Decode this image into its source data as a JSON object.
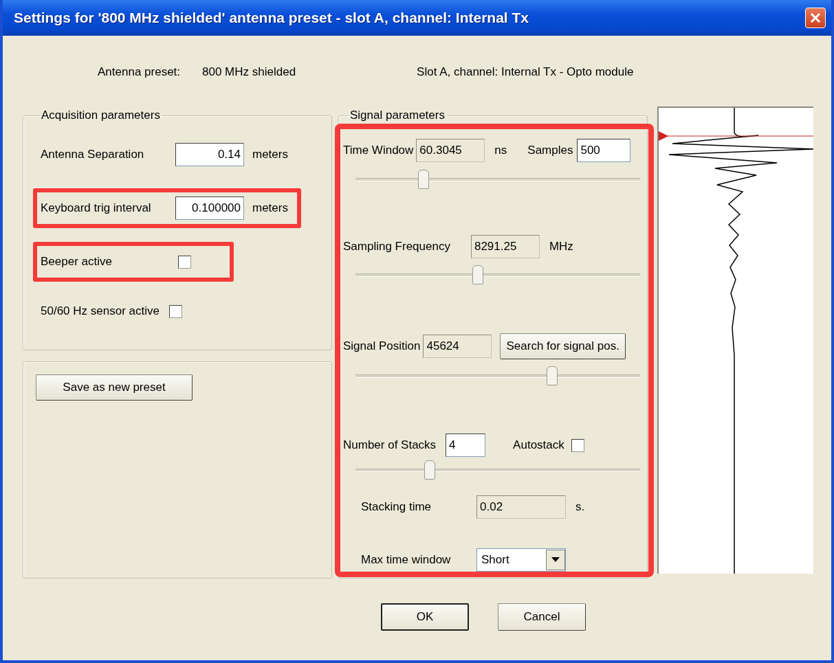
{
  "window": {
    "title": "Settings for '800 MHz shielded' antenna preset - slot A, channel: Internal Tx"
  },
  "header": {
    "preset_label": "Antenna preset:",
    "preset_value": "800 MHz shielded",
    "channel": "Slot A, channel: Internal Tx - Opto module"
  },
  "acquisition": {
    "title": "Acquisition parameters",
    "rows": [
      {
        "kind": "field",
        "label": "Antenna Separation",
        "value": "0.14",
        "unit": "meters",
        "highlighted": false
      },
      {
        "kind": "field",
        "label": "Keyboard trig interval",
        "value": "0.100000",
        "unit": "meters",
        "highlighted": true
      },
      {
        "kind": "checkbox",
        "label": "Beeper active",
        "checked": false,
        "highlighted": true
      },
      {
        "kind": "checkbox",
        "label": "50/60 Hz sensor active",
        "checked": false,
        "highlighted": false
      }
    ]
  },
  "preset_button": "Save as new preset",
  "signal": {
    "title": "Signal parameters",
    "highlighted": true,
    "time_window": {
      "label": "Time Window",
      "value": "60.3045",
      "unit": "ns",
      "samples_label": "Samples",
      "samples_value": "500",
      "level": 0.24
    },
    "sampling_frequency": {
      "label": "Sampling Frequency",
      "value": "8291.25",
      "unit": "MHz",
      "level": 0.43
    },
    "signal_position": {
      "label": "Signal Position",
      "value": "45624",
      "button": "Search for signal pos.",
      "level": 0.69
    },
    "stacks": {
      "label": "Number of Stacks",
      "value": "4",
      "autostack_label": "Autostack",
      "autostack_checked": false,
      "level": 0.26
    },
    "stacking_time": {
      "label": "Stacking time",
      "value": "0.02",
      "unit": "s."
    },
    "max_time_window": {
      "label": "Max time window",
      "value": "Short"
    }
  },
  "buttons": [
    {
      "label": "OK",
      "default": true
    },
    {
      "label": "Cancel",
      "default": false
    }
  ]
}
